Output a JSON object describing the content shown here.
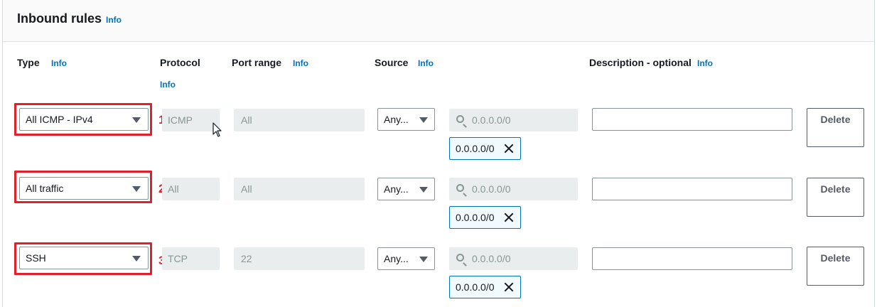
{
  "panel": {
    "title": "Inbound rules",
    "info": "Info"
  },
  "columns": {
    "type": "Type",
    "protocol": "Protocol",
    "port_range": "Port range",
    "source": "Source",
    "description": "Description - optional",
    "info": "Info"
  },
  "rows": [
    {
      "number": "1",
      "type": "All ICMP - IPv4",
      "protocol": "ICMP",
      "port_range": "All",
      "source": "Any...",
      "search_placeholder": "0.0.0.0/0",
      "token": "0.0.0.0/0",
      "description": "",
      "delete_label": "Delete"
    },
    {
      "number": "2",
      "type": "All traffic",
      "protocol": "All",
      "port_range": "All",
      "source": "Any...",
      "search_placeholder": "0.0.0.0/0",
      "token": "0.0.0.0/0",
      "description": "",
      "delete_label": "Delete"
    },
    {
      "number": "3",
      "type": "SSH",
      "protocol": "TCP",
      "port_range": "22",
      "source": "Any...",
      "search_placeholder": "0.0.0.0/0",
      "token": "0.0.0.0/0",
      "description": "",
      "delete_label": "Delete"
    }
  ],
  "colors": {
    "accent": "#0073bb",
    "highlight": "#e0202b",
    "disabled_bg": "#eaeded"
  },
  "icons": {
    "caret": "caret-down-icon",
    "search": "search-icon",
    "remove": "close-icon",
    "pointer": "mouse-pointer-icon"
  }
}
